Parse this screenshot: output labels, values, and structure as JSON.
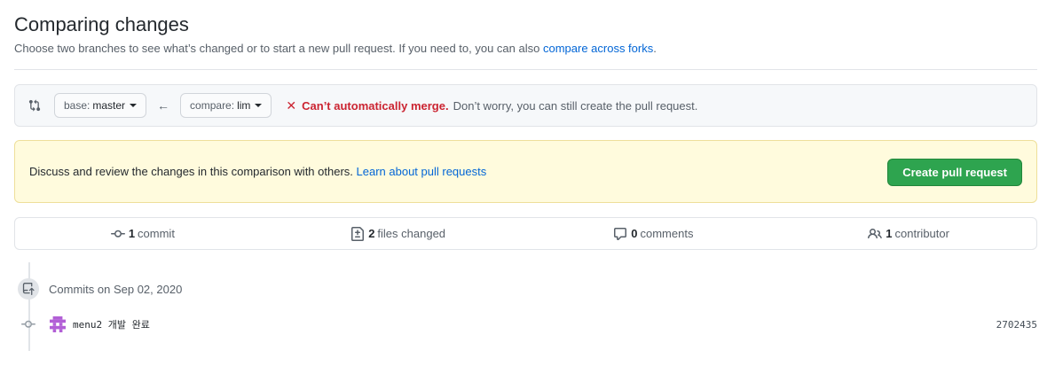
{
  "page": {
    "title": "Comparing changes",
    "subtitle_text": "Choose two branches to see what’s changed or to start a new pull request. If you need to, you can also ",
    "subtitle_link": "compare across forks",
    "subtitle_end": "."
  },
  "range": {
    "base_prefix": "base:",
    "base_branch": "master",
    "compare_prefix": "compare:",
    "compare_branch": "lim",
    "merge_status": "Can’t automatically merge.",
    "merge_note": "Don’t worry, you can still create the pull request.",
    "status_color": "#cb2431"
  },
  "flash": {
    "text": "Discuss and review the changes in this comparison with others. ",
    "link": "Learn about pull requests",
    "button": "Create pull request",
    "button_color": "#2ea44f"
  },
  "numbers": [
    {
      "icon": "commit-icon",
      "count": "1",
      "label": "commit"
    },
    {
      "icon": "file-diff-icon",
      "count": "2",
      "label": "files changed"
    },
    {
      "icon": "comment-icon",
      "count": "0",
      "label": "comments"
    },
    {
      "icon": "people-icon",
      "count": "1",
      "label": "contributor"
    }
  ],
  "commits": {
    "heading": "Commits on Sep 02, 2020",
    "items": [
      {
        "message": "menu2 개발 완료",
        "sha": "2702435"
      }
    ]
  }
}
